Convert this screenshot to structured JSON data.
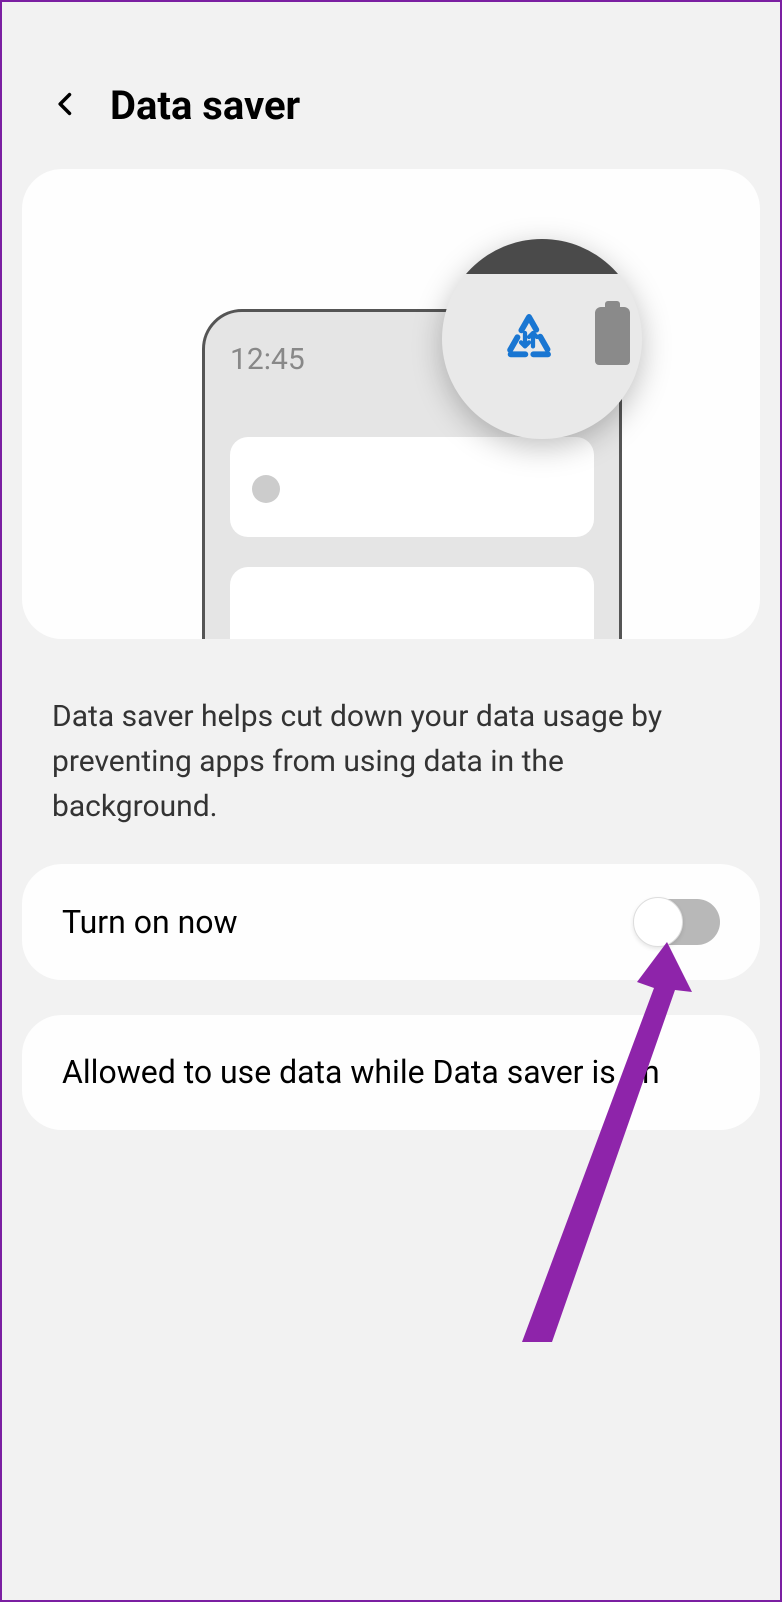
{
  "header": {
    "title": "Data saver"
  },
  "illustration": {
    "time": "12:45"
  },
  "description": "Data saver helps cut down your data usage by preventing apps from using data in the background.",
  "settings": {
    "turn_on": {
      "label": "Turn on now",
      "enabled": false
    },
    "allowed": {
      "label": "Allowed to use data while Data saver is on"
    }
  },
  "colors": {
    "accent": "#1976d2",
    "annotation": "#8e24aa"
  }
}
